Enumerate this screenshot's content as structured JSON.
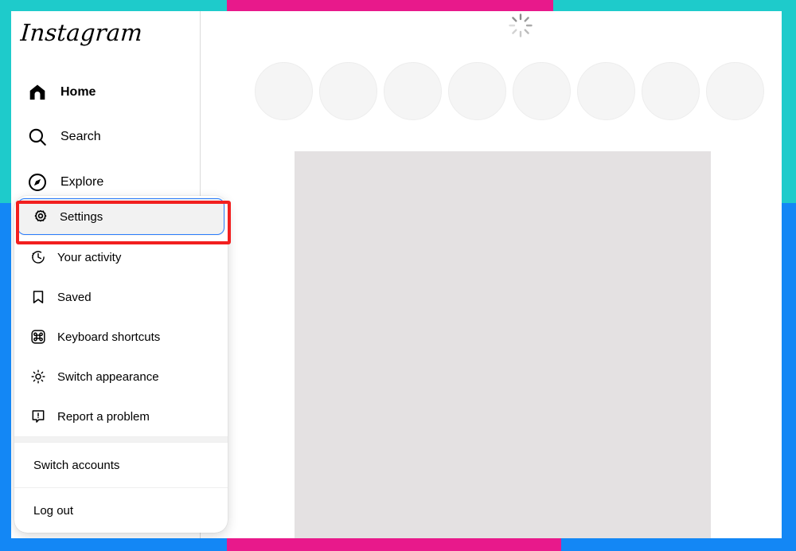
{
  "frame": {
    "teal": "#1ECBCB",
    "pink": "#E8198B",
    "blue": "#1387F5",
    "annotation_color": "#F21F1F"
  },
  "app": {
    "brand": "Instagram"
  },
  "sidebar": {
    "items": [
      {
        "label": "Home",
        "icon": "home-icon",
        "active": true
      },
      {
        "label": "Search",
        "icon": "search-icon",
        "active": false
      },
      {
        "label": "Explore",
        "icon": "compass-icon",
        "active": false
      }
    ]
  },
  "menu": {
    "items": [
      {
        "label": "Settings",
        "icon": "gear-icon",
        "highlighted": true
      },
      {
        "label": "Your activity",
        "icon": "activity-clock-icon",
        "highlighted": false
      },
      {
        "label": "Saved",
        "icon": "bookmark-icon",
        "highlighted": false
      },
      {
        "label": "Keyboard shortcuts",
        "icon": "keyboard-command-icon",
        "highlighted": false
      },
      {
        "label": "Switch appearance",
        "icon": "sun-brightness-icon",
        "highlighted": false
      },
      {
        "label": "Report a problem",
        "icon": "alert-exclamation-icon",
        "highlighted": false
      }
    ],
    "footer": [
      {
        "label": "Switch accounts"
      },
      {
        "label": "Log out"
      }
    ]
  },
  "main": {
    "loading_indicator": "spinner-icon",
    "stories_count": 8,
    "post_placeholder": "loading-post-skeleton"
  }
}
